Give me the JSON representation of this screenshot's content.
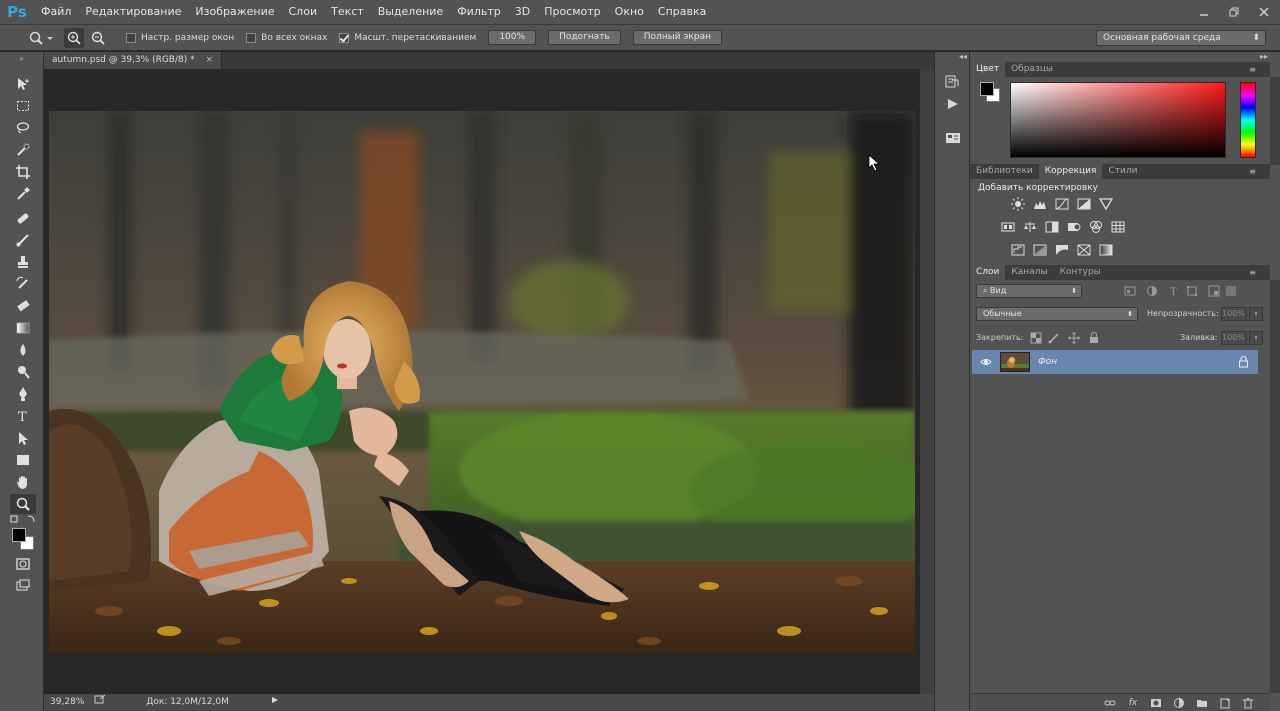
{
  "app": {
    "logo": "Ps"
  },
  "menu": [
    "Файл",
    "Редактирование",
    "Изображение",
    "Слои",
    "Текст",
    "Выделение",
    "Фильтр",
    "3D",
    "Просмотр",
    "Окно",
    "Справка"
  ],
  "options_bar": {
    "tool_icon": "zoom-icon",
    "zoom_in_icon": "zoom-in-icon",
    "zoom_out_icon": "zoom-out-icon",
    "checks": [
      {
        "label": "Настр. размер окон",
        "checked": false
      },
      {
        "label": "Во всех окнах",
        "checked": false
      },
      {
        "label": "Масшт. перетаскиванием",
        "checked": true
      }
    ],
    "buttons": [
      "100%",
      "Подогнать",
      "Полный экран"
    ],
    "workspace": "Основная рабочая среда"
  },
  "document": {
    "tab_title": "autumn.psd @ 39,3% (RGB/8) *",
    "close": "×",
    "zoom": "39,28%",
    "doc_size": "Док: 12,0M/12,0M"
  },
  "panels": {
    "color_tabs": [
      "Цвет",
      "Образцы"
    ],
    "adjust_tabs": [
      "Библиотеки",
      "Коррекция",
      "Стили"
    ],
    "adjust_title": "Добавить корректировку",
    "layers_tabs": [
      "Слои",
      "Каналы",
      "Контуры"
    ],
    "layers_filter": "Вид",
    "blend_mode": "Обычные",
    "opacity_label": "Непрозрачность:",
    "opacity_value": "100%",
    "lock_label": "Закрепить:",
    "fill_label": "Заливка:",
    "fill_value": "100%",
    "layer_name": "Фон",
    "bottom_fx": "fx"
  },
  "colors": {
    "foreground": "#000000",
    "background": "#ffffff",
    "accent_layer": "#6a86ae",
    "ps_blue": "#35a8e0"
  }
}
